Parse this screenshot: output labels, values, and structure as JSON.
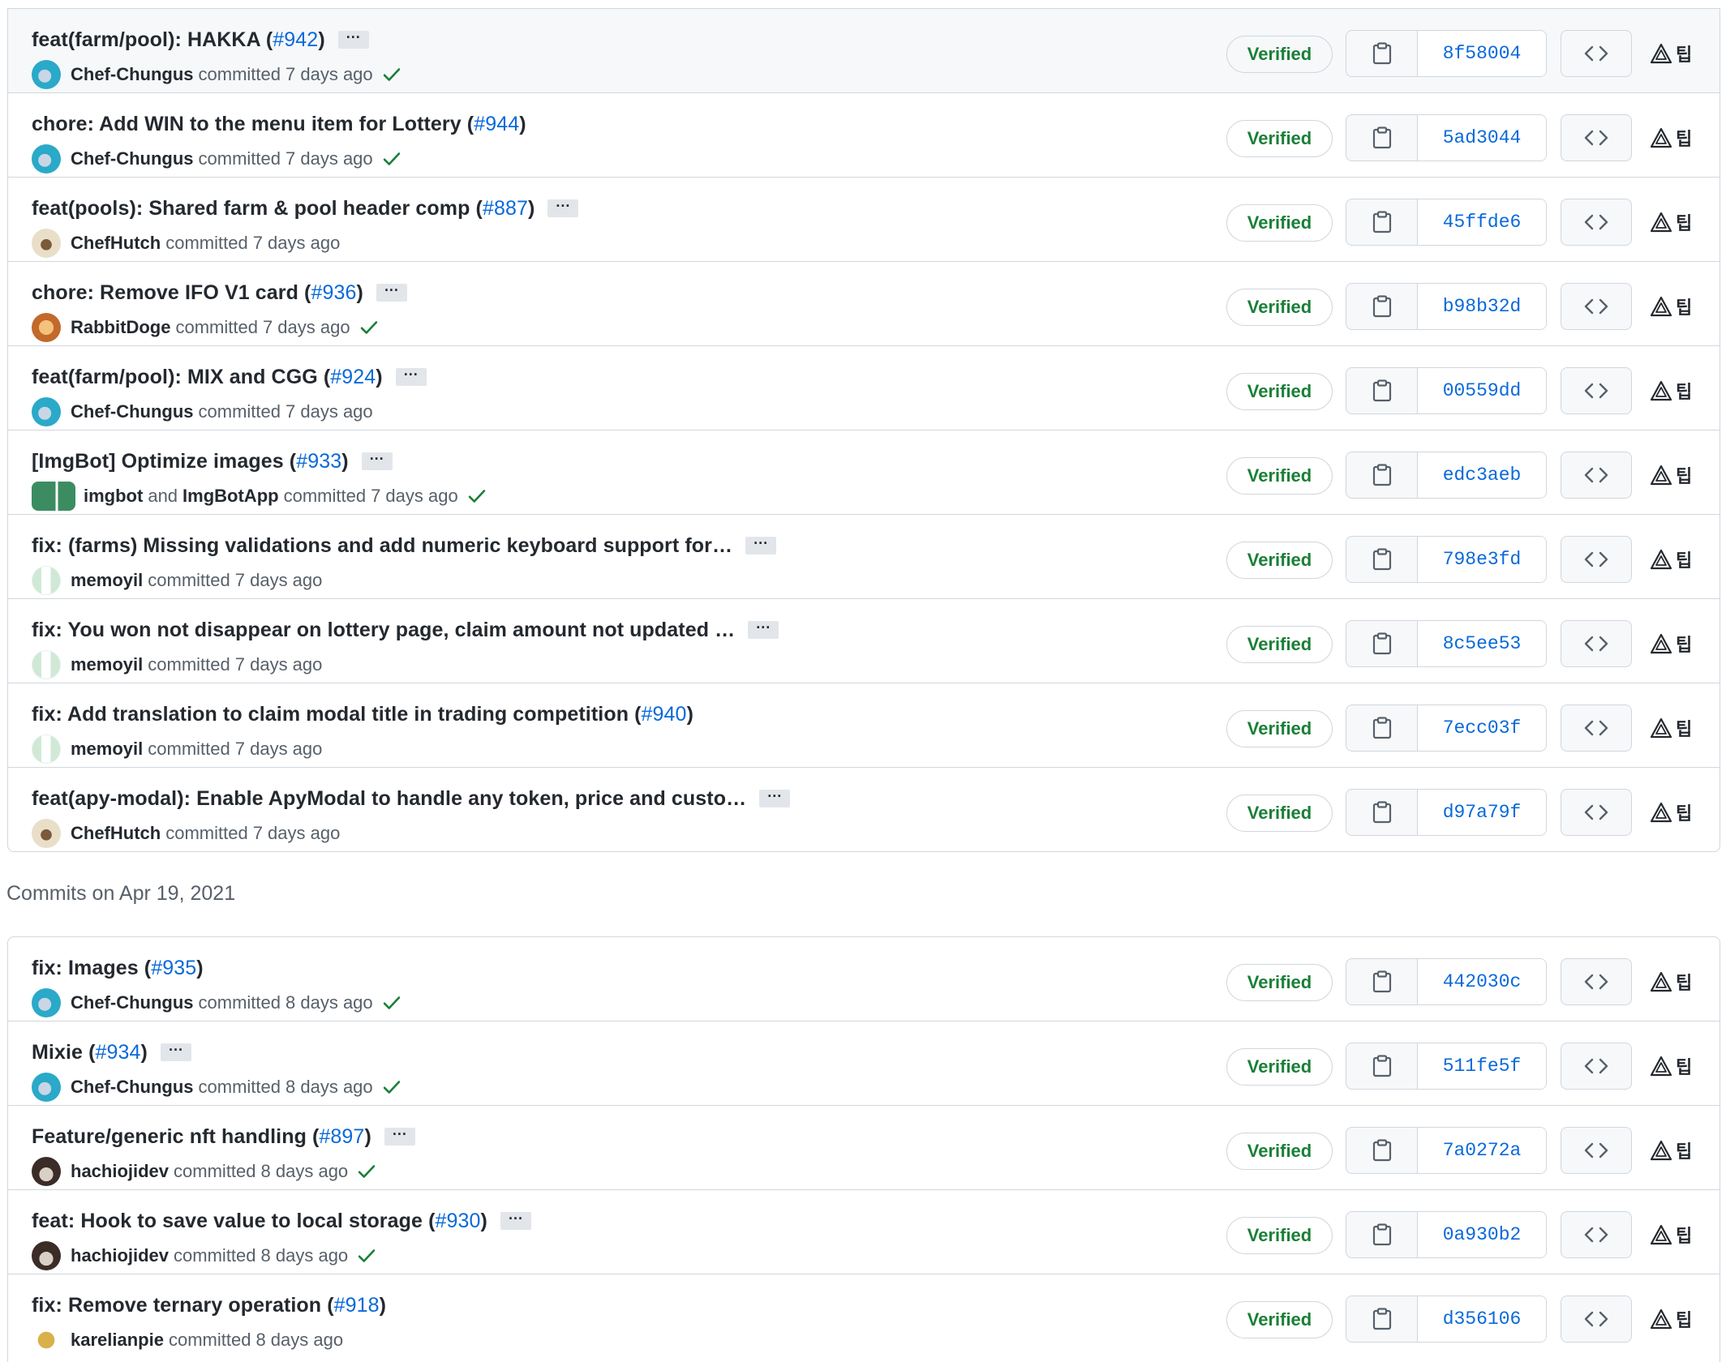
{
  "section_heading": "Commits on Apr 19, 2021",
  "committed_word": "committed",
  "and_word": "and",
  "verified_label": "Verified",
  "colors": {
    "verified_green": "#1a7f37",
    "link_blue": "#0969da",
    "border": "#d0d7de"
  },
  "icons": {
    "copy": "clipboard-icon",
    "browse": "code-icon",
    "tip": "tip-icon",
    "check": "check-icon"
  },
  "groups": [
    {
      "commits": [
        {
          "title": "feat(farm/pool): HAKKA (",
          "pr": "#942",
          "close": ")",
          "ellipsis": "···",
          "author": "Chef-Chungus",
          "coauthor": "",
          "time": "7 days ago",
          "check": true,
          "sha": "8f58004",
          "tip": "팁"
        },
        {
          "title": "chore: Add WIN to the menu item for Lottery (",
          "pr": "#944",
          "close": ")",
          "ellipsis": "",
          "author": "Chef-Chungus",
          "coauthor": "",
          "time": "7 days ago",
          "check": true,
          "sha": "5ad3044",
          "tip": "팁"
        },
        {
          "title": "feat(pools): Shared farm & pool header comp (",
          "pr": "#887",
          "close": ")",
          "ellipsis": "···",
          "author": "ChefHutch",
          "coauthor": "",
          "time": "7 days ago",
          "check": false,
          "sha": "45ffde6",
          "tip": "팁"
        },
        {
          "title": "chore: Remove IFO V1 card (",
          "pr": "#936",
          "close": ")",
          "ellipsis": "···",
          "author": "RabbitDoge",
          "coauthor": "",
          "time": "7 days ago",
          "check": true,
          "sha": "b98b32d",
          "tip": "팁"
        },
        {
          "title": "feat(farm/pool): MIX and CGG (",
          "pr": "#924",
          "close": ")",
          "ellipsis": "···",
          "author": "Chef-Chungus",
          "coauthor": "",
          "time": "7 days ago",
          "check": false,
          "sha": "00559dd",
          "tip": "팁"
        },
        {
          "title": "[ImgBot] Optimize images (",
          "pr": "#933",
          "close": ")",
          "ellipsis": "···",
          "author": "imgbot",
          "coauthor": "ImgBotApp",
          "time": "7 days ago",
          "check": true,
          "sha": "edc3aeb",
          "tip": "팁"
        },
        {
          "title": "fix: (farms) Missing validations and add numeric keyboard support for…",
          "pr": "",
          "close": "",
          "ellipsis": "···",
          "author": "memoyil",
          "coauthor": "",
          "time": "7 days ago",
          "check": false,
          "sha": "798e3fd",
          "tip": "팁"
        },
        {
          "title": "fix: You won not disappear on lottery page, claim amount not updated …",
          "pr": "",
          "close": "",
          "ellipsis": "···",
          "author": "memoyil",
          "coauthor": "",
          "time": "7 days ago",
          "check": false,
          "sha": "8c5ee53",
          "tip": "팁"
        },
        {
          "title": "fix: Add translation to claim modal title in trading competition (",
          "pr": "#940",
          "close": ")",
          "ellipsis": "",
          "author": "memoyil",
          "coauthor": "",
          "time": "7 days ago",
          "check": false,
          "sha": "7ecc03f",
          "tip": "팁"
        },
        {
          "title": "feat(apy-modal): Enable ApyModal to handle any token, price and custo…",
          "pr": "",
          "close": "",
          "ellipsis": "···",
          "author": "ChefHutch",
          "coauthor": "",
          "time": "7 days ago",
          "check": false,
          "sha": "d97a79f",
          "tip": "팁"
        }
      ]
    },
    {
      "commits": [
        {
          "title": "fix: Images (",
          "pr": "#935",
          "close": ")",
          "ellipsis": "",
          "author": "Chef-Chungus",
          "coauthor": "",
          "time": "8 days ago",
          "check": true,
          "sha": "442030c",
          "tip": "팁"
        },
        {
          "title": "Mixie (",
          "pr": "#934",
          "close": ")",
          "ellipsis": "···",
          "author": "Chef-Chungus",
          "coauthor": "",
          "time": "8 days ago",
          "check": true,
          "sha": "511fe5f",
          "tip": "팁"
        },
        {
          "title": "Feature/generic nft handling (",
          "pr": "#897",
          "close": ")",
          "ellipsis": "···",
          "author": "hachiojidev",
          "coauthor": "",
          "time": "8 days ago",
          "check": true,
          "sha": "7a0272a",
          "tip": "팁"
        },
        {
          "title": "feat: Hook to save value to local storage (",
          "pr": "#930",
          "close": ")",
          "ellipsis": "···",
          "author": "hachiojidev",
          "coauthor": "",
          "time": "8 days ago",
          "check": true,
          "sha": "0a930b2",
          "tip": "팁"
        },
        {
          "title": "fix: Remove ternary operation (",
          "pr": "#918",
          "close": ")",
          "ellipsis": "",
          "author": "karelianpie",
          "coauthor": "",
          "time": "8 days ago",
          "check": false,
          "sha": "d356106",
          "tip": "팁"
        }
      ]
    }
  ]
}
